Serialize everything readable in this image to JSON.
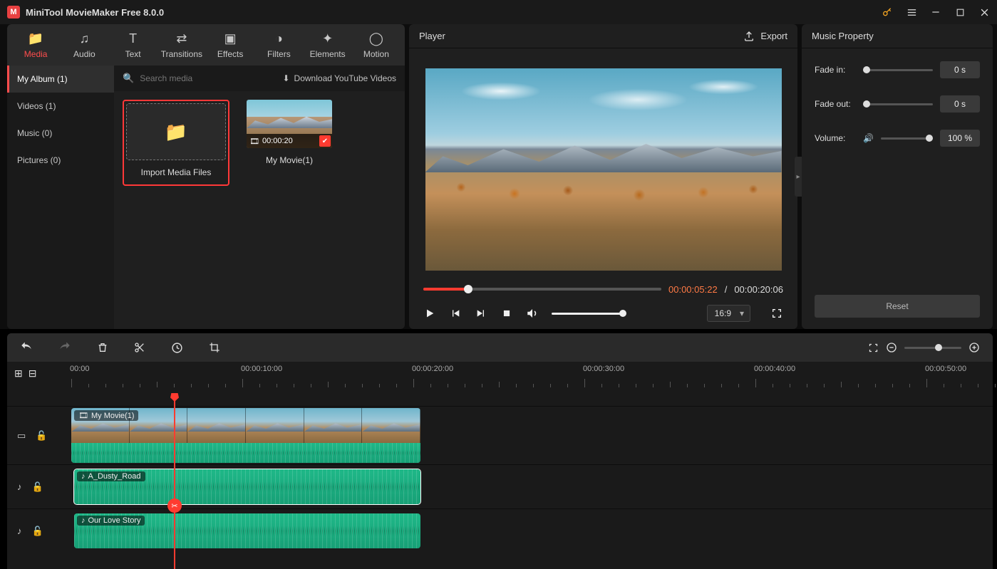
{
  "title": "MiniTool MovieMaker Free 8.0.0",
  "tabs": [
    {
      "label": "Media",
      "icon": "folder"
    },
    {
      "label": "Audio",
      "icon": "music"
    },
    {
      "label": "Text",
      "icon": "text"
    },
    {
      "label": "Transitions",
      "icon": "transition"
    },
    {
      "label": "Effects",
      "icon": "effects"
    },
    {
      "label": "Filters",
      "icon": "filters"
    },
    {
      "label": "Elements",
      "icon": "sparkle"
    },
    {
      "label": "Motion",
      "icon": "motion"
    }
  ],
  "active_tab": 0,
  "albums": [
    {
      "label": "My Album (1)",
      "active": true
    },
    {
      "label": "Videos (1)"
    },
    {
      "label": "Music (0)"
    },
    {
      "label": "Pictures (0)"
    }
  ],
  "search": {
    "placeholder": "Search media"
  },
  "download_link": "Download YouTube Videos",
  "import_label": "Import Media Files",
  "media_items": [
    {
      "duration": "00:00:20",
      "name": "My Movie(1)"
    }
  ],
  "player": {
    "title": "Player",
    "export": "Export",
    "current": "00:00:05:22",
    "total": "00:00:20:06",
    "aspect": "16:9"
  },
  "props": {
    "title": "Music Property",
    "fade_in": {
      "label": "Fade in:",
      "value": "0 s"
    },
    "fade_out": {
      "label": "Fade out:",
      "value": "0 s"
    },
    "volume": {
      "label": "Volume:",
      "value": "100 %"
    },
    "reset": "Reset"
  },
  "ruler_labels": [
    "00:00",
    "00:00:10:00",
    "00:00:20:00",
    "00:00:30:00",
    "00:00:40:00",
    "00:00:50:00"
  ],
  "tracks": {
    "video_clip": {
      "label": "My Movie(1)"
    },
    "audio1": {
      "label": "A_Dusty_Road"
    },
    "audio2": {
      "label": "Our Love Story"
    }
  }
}
